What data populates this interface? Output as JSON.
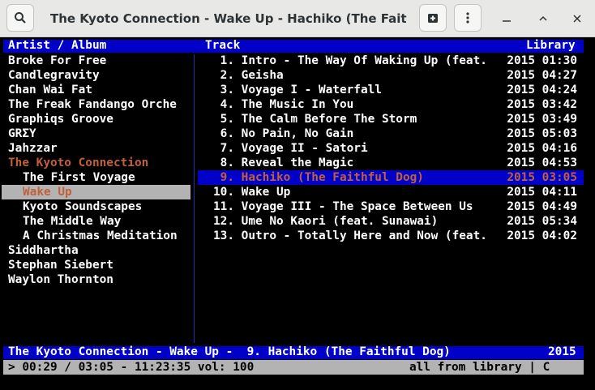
{
  "window": {
    "title": "The Kyoto Connection - Wake Up - Hachiko (The Faithful …"
  },
  "headers": {
    "left": "Artist / Album",
    "middle": "Track",
    "right": "Library"
  },
  "artists": [
    {
      "label": "Broke For Free"
    },
    {
      "label": "Candlegravity"
    },
    {
      "label": "Chan Wai Fat"
    },
    {
      "label": "The Freak Fandango Orche"
    },
    {
      "label": "Graphiqs Groove"
    },
    {
      "label": "GRƩY"
    },
    {
      "label": "Jahzzar"
    },
    {
      "label": "The Kyoto Connection"
    }
  ],
  "albums": [
    {
      "label": "The First Voyage"
    },
    {
      "label": "Wake Up"
    },
    {
      "label": "Kyoto Soundscapes"
    },
    {
      "label": "The Middle Way"
    },
    {
      "label": "A Christmas Meditation"
    }
  ],
  "artists_after": [
    {
      "label": "Siddhartha"
    },
    {
      "label": "Stephan Siebert"
    },
    {
      "label": "Waylon Thornton"
    }
  ],
  "tracks": [
    {
      "num": "1.",
      "title": "Intro - The Way Of Waking Up (feat.",
      "date": "2015 01:30"
    },
    {
      "num": "2.",
      "title": "Geisha",
      "date": "2015 04:27"
    },
    {
      "num": "3.",
      "title": "Voyage I - Waterfall",
      "date": "2015 04:24"
    },
    {
      "num": "4.",
      "title": "The Music In You",
      "date": "2015 03:42"
    },
    {
      "num": "5.",
      "title": "The Calm Before The Storm",
      "date": "2015 03:49"
    },
    {
      "num": "6.",
      "title": "No Pain, No Gain",
      "date": "2015 05:03"
    },
    {
      "num": "7.",
      "title": "Voyage II - Satori",
      "date": "2015 04:16"
    },
    {
      "num": "8.",
      "title": "Reveal the Magic",
      "date": "2015 04:53"
    },
    {
      "num": "9.",
      "title": "Hachiko (The Faithful Dog)",
      "date": "2015 03:05"
    },
    {
      "num": "10.",
      "title": "Wake Up",
      "date": "2015 04:11"
    },
    {
      "num": "11.",
      "title": "Voyage III - The Space Between Us",
      "date": "2015 04:49"
    },
    {
      "num": "12.",
      "title": "Ume No Kaori (feat. Sunawai)",
      "date": "2015 05:34"
    },
    {
      "num": "13.",
      "title": "Outro - Totally Here and Now (feat.",
      "date": "2015 04:02"
    }
  ],
  "status": {
    "now_playing": "The Kyoto Connection - Wake Up -  9. Hachiko (The Faithful Dog)",
    "year": "2015"
  },
  "command": {
    "left": "> 00:29 / 03:05 - 11:23:35 vol: 100",
    "right": "all from library | C"
  },
  "colors": {
    "bar_blue": "#0000c8",
    "accent_orange": "#c2603a",
    "selection_grey": "#b3b3b3"
  }
}
